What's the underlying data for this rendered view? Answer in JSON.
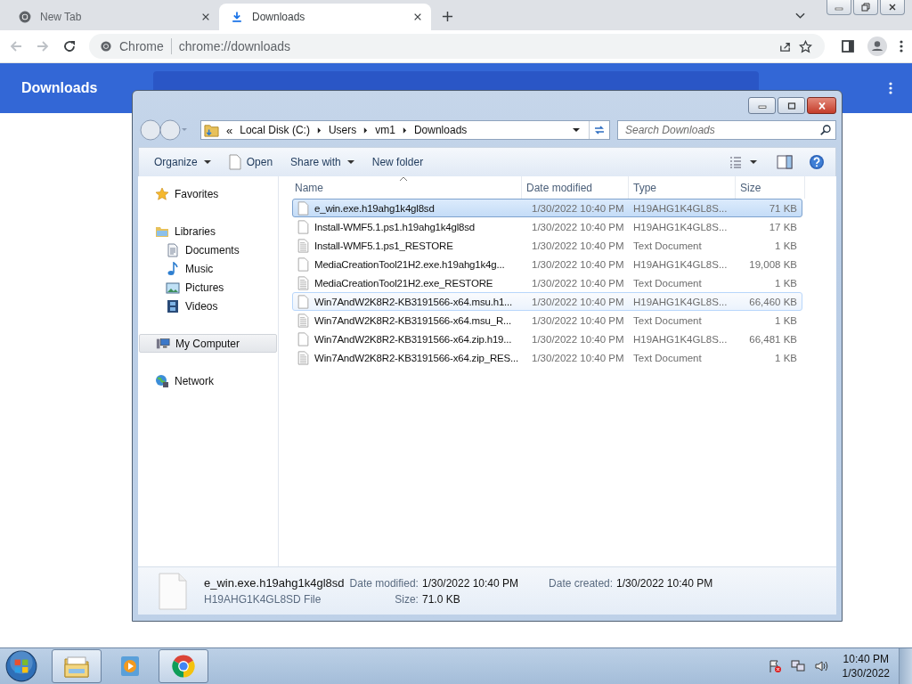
{
  "browser": {
    "tabs": [
      {
        "label": "New Tab",
        "kind": "newtab",
        "selected": false
      },
      {
        "label": "Downloads",
        "kind": "download",
        "selected": true
      }
    ],
    "omnibox": {
      "site": "Chrome",
      "url": "chrome://downloads"
    },
    "page": {
      "title": "Downloads"
    }
  },
  "explorer": {
    "breadcrumb_overflow": "«",
    "breadcrumb": [
      "Local Disk (C:)",
      "Users",
      "vm1",
      "Downloads"
    ],
    "search": {
      "placeholder": "Search Downloads"
    },
    "toolbar": [
      {
        "label": "Organize",
        "kind": "menu"
      },
      {
        "label": "Open",
        "kind": "file"
      },
      {
        "label": "Share with",
        "kind": "menu"
      },
      {
        "label": "New folder",
        "kind": "plain"
      }
    ],
    "sidebar": [
      {
        "label": "Favorites",
        "kind": "star",
        "selected": false
      },
      {
        "label": "Libraries",
        "kind": "library",
        "selected": false,
        "children": [
          {
            "label": "Documents",
            "kind": "documents",
            "selected": false
          },
          {
            "label": "Music",
            "kind": "music",
            "selected": false
          },
          {
            "label": "Pictures",
            "kind": "pictures",
            "selected": false
          },
          {
            "label": "Videos",
            "kind": "videos",
            "selected": false
          }
        ]
      },
      {
        "label": "My Computer",
        "kind": "computer",
        "selected": true
      },
      {
        "label": "Network",
        "kind": "network",
        "selected": false
      }
    ],
    "columns": [
      {
        "label": "Name",
        "sorted": true
      },
      {
        "label": "Date modified",
        "sorted": false
      },
      {
        "label": "Type",
        "sorted": false
      },
      {
        "label": "Size",
        "sorted": false
      }
    ],
    "rows": [
      {
        "name": "e_win.exe.h19ahg1k4gl8sd",
        "date": "1/30/2022 10:40 PM",
        "type": "H19AHG1K4GL8S...",
        "size": "71 KB",
        "kind": "file",
        "selected": true,
        "hovered": false
      },
      {
        "name": "Install-WMF5.1.ps1.h19ahg1k4gl8sd",
        "date": "1/30/2022 10:40 PM",
        "type": "H19AHG1K4GL8S...",
        "size": "17 KB",
        "kind": "file",
        "selected": false,
        "hovered": false
      },
      {
        "name": "Install-WMF5.1.ps1_RESTORE",
        "date": "1/30/2022 10:40 PM",
        "type": "Text Document",
        "size": "1 KB",
        "kind": "text",
        "selected": false,
        "hovered": false
      },
      {
        "name": "MediaCreationTool21H2.exe.h19ahg1k4g...",
        "date": "1/30/2022 10:40 PM",
        "type": "H19AHG1K4GL8S...",
        "size": "19,008 KB",
        "kind": "file",
        "selected": false,
        "hovered": false
      },
      {
        "name": "MediaCreationTool21H2.exe_RESTORE",
        "date": "1/30/2022 10:40 PM",
        "type": "Text Document",
        "size": "1 KB",
        "kind": "text",
        "selected": false,
        "hovered": false
      },
      {
        "name": "Win7AndW2K8R2-KB3191566-x64.msu.h1...",
        "date": "1/30/2022 10:40 PM",
        "type": "H19AHG1K4GL8S...",
        "size": "66,460 KB",
        "kind": "file",
        "selected": false,
        "hovered": true
      },
      {
        "name": "Win7AndW2K8R2-KB3191566-x64.msu_R...",
        "date": "1/30/2022 10:40 PM",
        "type": "Text Document",
        "size": "1 KB",
        "kind": "text",
        "selected": false,
        "hovered": false
      },
      {
        "name": "Win7AndW2K8R2-KB3191566-x64.zip.h19...",
        "date": "1/30/2022 10:40 PM",
        "type": "H19AHG1K4GL8S...",
        "size": "66,481 KB",
        "kind": "file",
        "selected": false,
        "hovered": false
      },
      {
        "name": "Win7AndW2K8R2-KB3191566-x64.zip_RES...",
        "date": "1/30/2022 10:40 PM",
        "type": "Text Document",
        "size": "1 KB",
        "kind": "text",
        "selected": false,
        "hovered": false
      }
    ],
    "details": {
      "name": "e_win.exe.h19ahg1k4gl8sd",
      "type": "H19AHG1K4GL8SD File",
      "fields": [
        {
          "label": "Date modified:",
          "value": "1/30/2022 10:40 PM"
        },
        {
          "label": "Date created:",
          "value": "1/30/2022 10:40 PM"
        },
        {
          "label": "Size:",
          "value": "71.0 KB"
        }
      ]
    }
  },
  "taskbar": {
    "apps": [
      {
        "kind": "explorer",
        "running": true
      },
      {
        "kind": "media",
        "running": false
      },
      {
        "kind": "chrome",
        "running": true
      }
    ],
    "clock": {
      "time": "10:40 PM",
      "date": "1/30/2022"
    }
  }
}
